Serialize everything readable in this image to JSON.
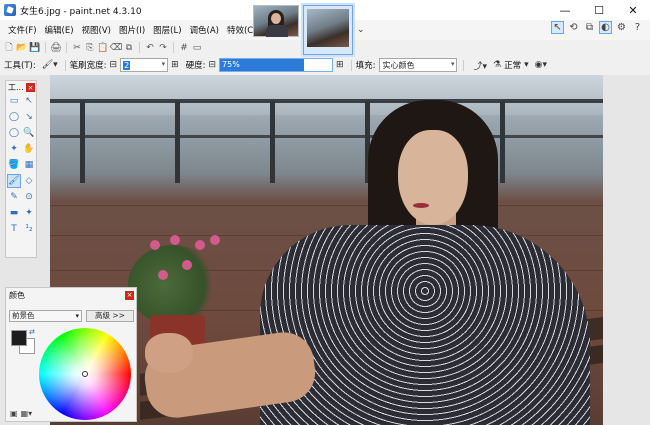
{
  "window": {
    "title": "女生6.jpg - paint.net 4.3.10",
    "controls": [
      "—",
      "☐",
      "✕"
    ]
  },
  "menu": [
    "文件(F)",
    "编辑(E)",
    "视图(V)",
    "图片(I)",
    "图层(L)",
    "调色(A)",
    "特效(C)"
  ],
  "thumbnails": {
    "more": "⌄"
  },
  "right_icons": [
    "↖",
    "⟲",
    "⧉",
    "◐",
    "⚙",
    "?"
  ],
  "toolbar_icons": [
    "🗋",
    "📂",
    "💾",
    "🖨",
    "✂",
    "⎘",
    "📋",
    "⌫",
    "⧉",
    "↶",
    "↷",
    "#",
    "▭"
  ],
  "options": {
    "tool_label": "工具(T):",
    "brush_width_label": "笔刷宽度:",
    "brush_width_value": "2",
    "hardness_label": "硬度:",
    "hardness_value": "75%",
    "hardness_fraction": 0.75,
    "fill_label": "填充:",
    "fill_value": "实心颜色",
    "blend_mode": "正常"
  },
  "tools_panel": {
    "title": "工...",
    "tools": [
      "▭",
      "↖",
      "◯",
      "↘",
      "◯",
      "🔍",
      "✦",
      "✋",
      "🪣",
      "▦",
      "🖌",
      "◇",
      "✎",
      "⊙",
      "▬",
      "✦",
      "T",
      "¹₂"
    ]
  },
  "color_panel": {
    "title": "颜色",
    "primary_select": "前景色",
    "advanced_button": "高级 >>",
    "primary_color": "#1d1d1d",
    "secondary_color": "#ffffff"
  }
}
